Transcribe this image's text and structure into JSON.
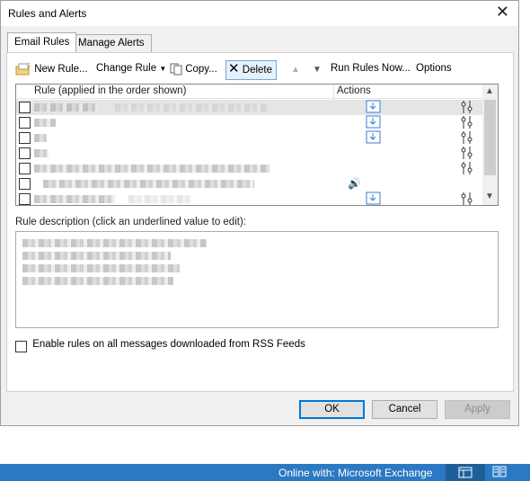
{
  "window": {
    "title": "Rules and Alerts",
    "close_glyph": "✕"
  },
  "tabs": [
    {
      "label": "Email Rules",
      "active": true
    },
    {
      "label": "Manage Alerts",
      "active": false
    }
  ],
  "toolbar": {
    "new_rule": "New Rule...",
    "change_rule": "Change Rule",
    "copy": "Copy...",
    "delete": "Delete",
    "run_rules_now": "Run Rules Now...",
    "options": "Options"
  },
  "rules_list": {
    "col_rule": "Rule (applied in the order shown)",
    "col_actions": "Actions"
  },
  "description": {
    "label": "Rule description (click an underlined value to edit):"
  },
  "rss_checkbox": {
    "label": "Enable rules on all messages downloaded from RSS Feeds",
    "checked": false
  },
  "buttons": {
    "ok": "OK",
    "cancel": "Cancel",
    "apply": "Apply"
  },
  "status_bar": {
    "text": "Online with: Microsoft Exchange"
  },
  "colors": {
    "accent": "#0078d7",
    "status_bar": "#2b79c2",
    "selected_row": "#e5e5e5"
  }
}
